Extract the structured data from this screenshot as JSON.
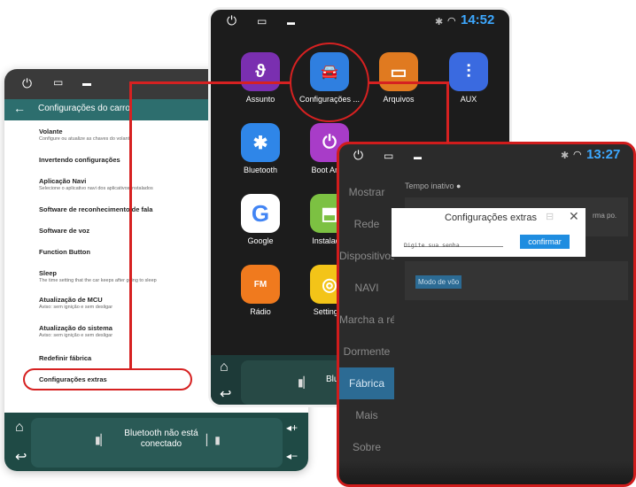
{
  "left_screen": {
    "status_icons": [
      "power-icon",
      "window-icon",
      "image-icon"
    ],
    "header_title": "Configurações do carro",
    "items": [
      {
        "title": "Volante",
        "subtitle": "Configure ou atualize as chaves do volante"
      },
      {
        "title": "Invertendo configurações",
        "subtitle": ""
      },
      {
        "title": "Aplicação Navi",
        "subtitle": "Selecione o aplicativo navi dos aplicativos instalados"
      },
      {
        "title": "Software de reconhecimento de fala",
        "subtitle": ""
      },
      {
        "title": "Software de voz",
        "subtitle": ""
      },
      {
        "title": "Function Button",
        "subtitle": ""
      },
      {
        "title": "Sleep",
        "subtitle": "The time setting that the car keeps after going to sleep"
      },
      {
        "title": "Atualização de MCU",
        "subtitle": "Aviso: sem ignição e sem desligar"
      },
      {
        "title": "Atualização do sistema",
        "subtitle": "Aviso: sem ignição e sem desligar"
      },
      {
        "title": "Redefinir fábrica",
        "subtitle": ""
      },
      {
        "title": "Configurações extras",
        "subtitle": ""
      }
    ],
    "bluetooth_line1": "Bluetooth não está",
    "bluetooth_line2": "conectado"
  },
  "mid_screen": {
    "time": "14:52",
    "apps": [
      {
        "label": "Assunto",
        "icon": "chameleon-icon",
        "color": "#7a2fb0"
      },
      {
        "label": "Configurações ...",
        "icon": "car-settings-icon",
        "color": "#2f7fe0"
      },
      {
        "label": "Arquivos",
        "icon": "folder-icon",
        "color": "#e07a20"
      },
      {
        "label": "AUX",
        "icon": "aux-icon",
        "color": "#3a6ae0"
      },
      {
        "label": "Bluetooth",
        "icon": "bluetooth-icon",
        "color": "#2f86e8"
      },
      {
        "label": "Boot Anim",
        "icon": "power-icon",
        "color": "#a83cc8"
      },
      {
        "label": "Google",
        "icon": "google-icon",
        "color": "#ffffff"
      },
      {
        "label": "Instalador",
        "icon": "android-icon",
        "color": "#7cc142"
      },
      {
        "label": "Rádio",
        "icon": "radio-icon",
        "color": "#f07a1e"
      },
      {
        "label": "SettingW",
        "icon": "steering-wheel-icon",
        "color": "#f3c418"
      }
    ],
    "dock_text": "Blu"
  },
  "right_screen": {
    "time": "13:27",
    "sidebar": [
      "Mostrar",
      "Rede",
      "Dispositivos",
      "NAVI",
      "Marcha a ré",
      "Dormente",
      "Fábrica",
      "Mais",
      "Sobre"
    ],
    "active_index": 6,
    "tempo_label": "Tempo inativo",
    "hint_text": "rma po.",
    "modo_voo": "Modo de vôo",
    "dialog": {
      "title": "Configurações extras",
      "placeholder": "Digite sua senha",
      "confirm": "confirmar"
    }
  },
  "colors": {
    "highlight_red": "#d62121",
    "header_teal": "#2d6e6e",
    "time_blue": "#3da8ff",
    "active_blue": "#2c6b94"
  }
}
